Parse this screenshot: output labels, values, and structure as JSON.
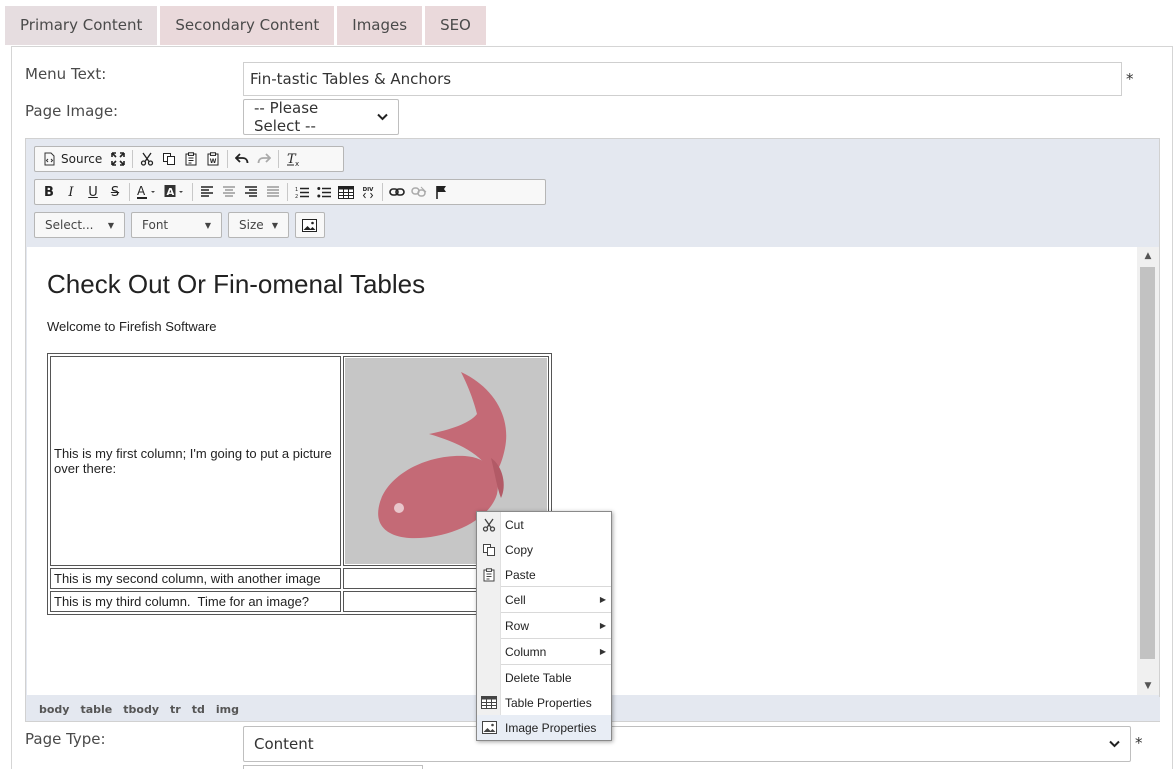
{
  "tabs": [
    "Primary Content",
    "Secondary Content",
    "Images",
    "SEO"
  ],
  "form": {
    "menu_text_label": "Menu Text:",
    "menu_text_value": "Fin-tastic Tables & Anchors",
    "required_mark": "*",
    "page_image_label": "Page Image:",
    "page_image_value": "-- Please Select --",
    "page_type_label": "Page Type:",
    "page_type_value": "Content"
  },
  "toolbar": {
    "source_label": "Source",
    "styles_combo": "Select...",
    "font_combo": "Font",
    "size_combo": "Size",
    "bold": "B",
    "italic": "I",
    "underline": "U",
    "strike": "S"
  },
  "document": {
    "title": "Check Out Or Fin-omenal Tables",
    "welcome": "Welcome to Firefish Software",
    "rows": [
      "This is my first column; I'm going to put a picture over there:",
      "This is my second column, with another image",
      "This is my third column.  Time for an image?"
    ]
  },
  "pathbar": [
    "body",
    "table",
    "tbody",
    "tr",
    "td",
    "img"
  ],
  "context_menu": {
    "items": [
      {
        "label": "Cut",
        "icon": "cut-icon"
      },
      {
        "label": "Copy",
        "icon": "copy-icon"
      },
      {
        "label": "Paste",
        "icon": "paste-icon"
      },
      {
        "label": "Cell",
        "submenu": true
      },
      {
        "label": "Row",
        "submenu": true
      },
      {
        "label": "Column",
        "submenu": true
      },
      {
        "label": "Delete Table"
      },
      {
        "label": "Table Properties",
        "icon": "table-icon"
      },
      {
        "label": "Image Properties",
        "icon": "image-icon"
      }
    ]
  },
  "colors": {
    "tab_bg": "#ead9db",
    "editor_bg": "#e4e8f0",
    "fish": "#c46a76"
  }
}
